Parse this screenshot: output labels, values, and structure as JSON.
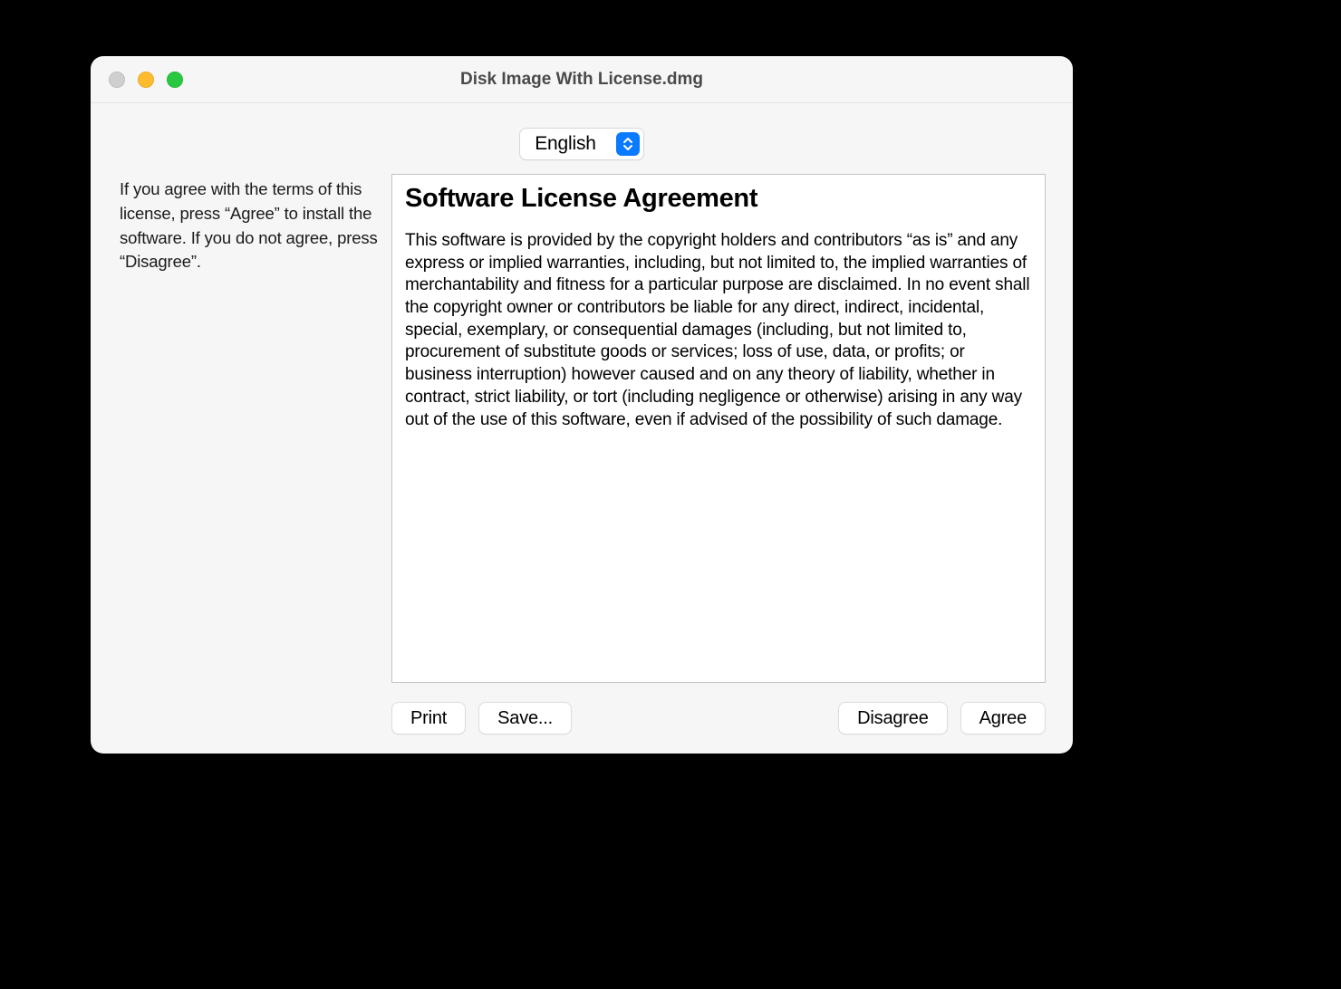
{
  "window": {
    "title": "Disk Image With License.dmg"
  },
  "language": {
    "selected": "English"
  },
  "sidebar": {
    "instructions": "If you agree with the terms of this license, press “Agree” to install the software. If you do not agree, press “Disagree”."
  },
  "license": {
    "heading": "Software License Agreement",
    "body": "This software is provided by the copyright holders and contributors “as is” and any express or implied warranties, including, but not limited to, the implied warranties of merchantability and fitness for a particular purpose are disclaimed. In no event shall the copyright owner or contributors be liable for any direct, indirect, incidental, special, exemplary, or consequential damages (including, but not limited to, procurement of substitute goods or services; loss of use, data, or profits; or business interruption) however caused and on any theory of liability, whether in contract, strict liability, or tort (including negligence or otherwise) arising in any way out of the use of this software, even if advised of the possibility of such damage."
  },
  "buttons": {
    "print": "Print",
    "save": "Save...",
    "disagree": "Disagree",
    "agree": "Agree"
  }
}
